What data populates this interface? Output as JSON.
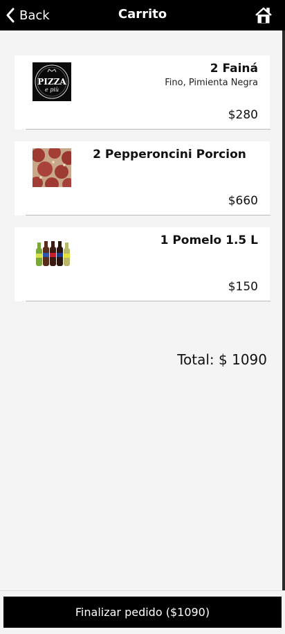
{
  "header": {
    "back_label": "Back",
    "title": "Carrito",
    "back_icon": "chevron-left-icon",
    "home_icon": "home-icon"
  },
  "cart": {
    "items": [
      {
        "name": "2 Fainá",
        "description": "Fino, Pimienta Negra",
        "price": "$280",
        "image": "pizza-e-piu-logo",
        "logo_text": "PIZZA",
        "logo_subtext": "e più"
      },
      {
        "name": "2 Pepperoncini Porcion",
        "description": "",
        "price": "$660",
        "image": "pepperoni-pizza-photo"
      },
      {
        "name": "1 Pomelo 1.5 L",
        "description": "",
        "price": "$150",
        "image": "soda-bottles-photo"
      }
    ],
    "total_label": "Total: $ 1090"
  },
  "footer": {
    "checkout_label": "Finalizar pedido ($1090)"
  },
  "colors": {
    "header_bg": "#000000",
    "page_bg": "#f4f4f4",
    "card_bg": "#ffffff",
    "button_bg": "#000000"
  }
}
